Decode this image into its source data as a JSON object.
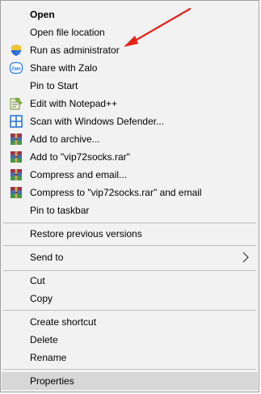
{
  "menu": {
    "items": [
      {
        "label": "Open"
      },
      {
        "label": "Open file location"
      },
      {
        "label": "Run as administrator",
        "icon": "uac-shield-icon"
      },
      {
        "label": "Share with Zalo",
        "icon": "zalo-icon",
        "icon_text": "Zalo"
      },
      {
        "label": "Pin to Start"
      },
      {
        "label": "Edit with Notepad++",
        "icon": "notepad-plus-plus-icon"
      },
      {
        "label": "Scan with Windows Defender...",
        "icon": "windows-defender-icon"
      },
      {
        "label": "Add to archive...",
        "icon": "winrar-icon"
      },
      {
        "label": "Add to \"vip72socks.rar\"",
        "icon": "winrar-icon"
      },
      {
        "label": "Compress and email...",
        "icon": "winrar-icon"
      },
      {
        "label": "Compress to \"vip72socks.rar\" and email",
        "icon": "winrar-icon"
      },
      {
        "label": "Pin to taskbar"
      },
      {
        "label": "Restore previous versions"
      },
      {
        "label": "Send to",
        "icon": "chevron-right-icon"
      },
      {
        "label": "Cut"
      },
      {
        "label": "Copy"
      },
      {
        "label": "Create shortcut"
      },
      {
        "label": "Delete"
      },
      {
        "label": "Rename"
      },
      {
        "label": "Properties"
      }
    ],
    "highlighted_item": "Properties"
  },
  "annotation": {
    "color": "#e8231a",
    "icon": "red-arrow-annotation"
  },
  "colors": {
    "menu_bg": "#f2f2f2",
    "hover_bg": "#d7d7d7",
    "separator": "#bdbdbd"
  }
}
